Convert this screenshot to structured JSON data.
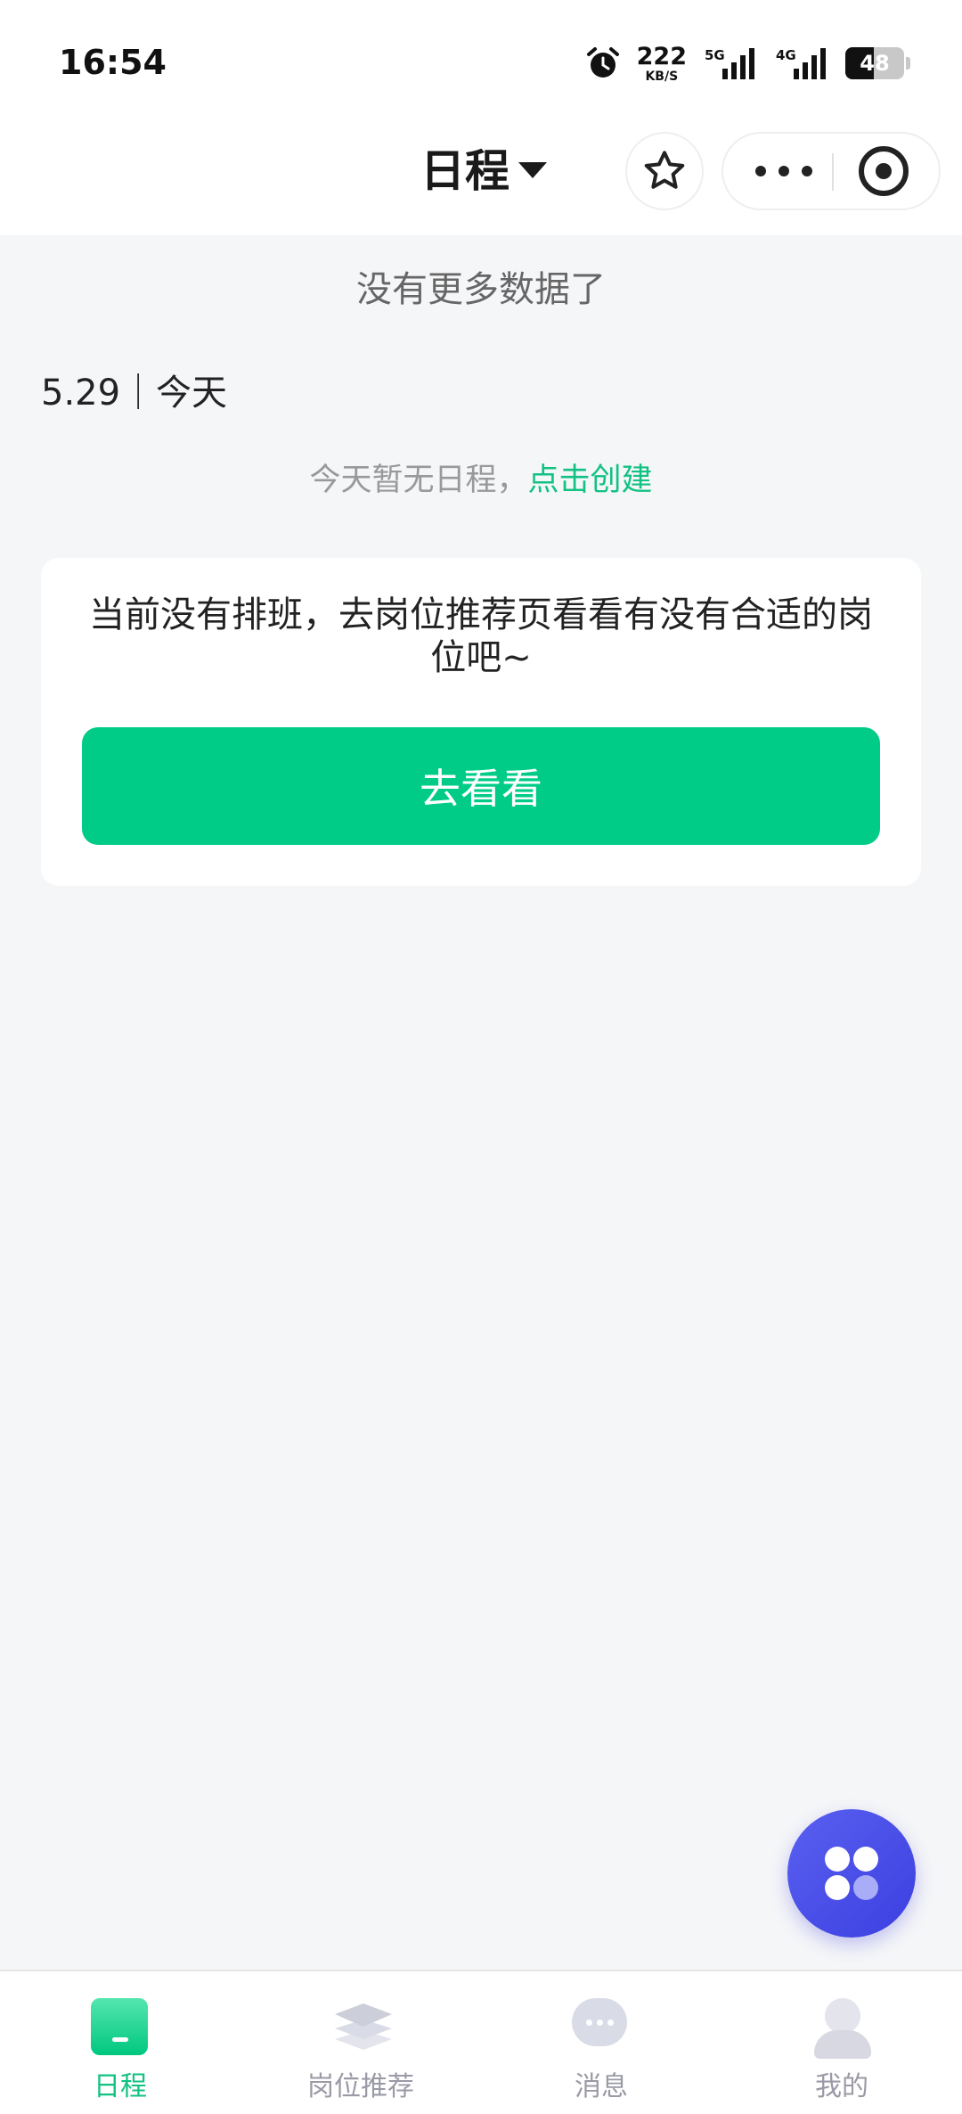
{
  "status_bar": {
    "time": "16:54",
    "net_speed_value": "222",
    "net_speed_unit": "KB/S",
    "signal_1_label": "5G",
    "signal_2_label": "4G",
    "battery_level": "48",
    "icons": [
      "alarm-icon",
      "signal-5g-icon",
      "signal-4g-icon",
      "battery-icon"
    ]
  },
  "nav": {
    "title": "日程"
  },
  "content": {
    "no_more_text": "没有更多数据了",
    "date_label": "5.29｜今天",
    "empty_prefix": "今天暂无日程，",
    "create_link": "点击创建",
    "card_message": "当前没有排班，去岗位推荐页看看有没有合适的岗位吧~",
    "card_button": "去看看"
  },
  "tabs": [
    {
      "label": "日程",
      "active": true,
      "icon": "calendar-icon"
    },
    {
      "label": "岗位推荐",
      "active": false,
      "icon": "layers-icon"
    },
    {
      "label": "消息",
      "active": false,
      "icon": "chat-bubble-icon"
    },
    {
      "label": "我的",
      "active": false,
      "icon": "user-icon"
    }
  ],
  "colors": {
    "accent": "#12c283",
    "button": "#00cc88",
    "fab": "#4a4fe8",
    "background": "#f5f6f8"
  }
}
